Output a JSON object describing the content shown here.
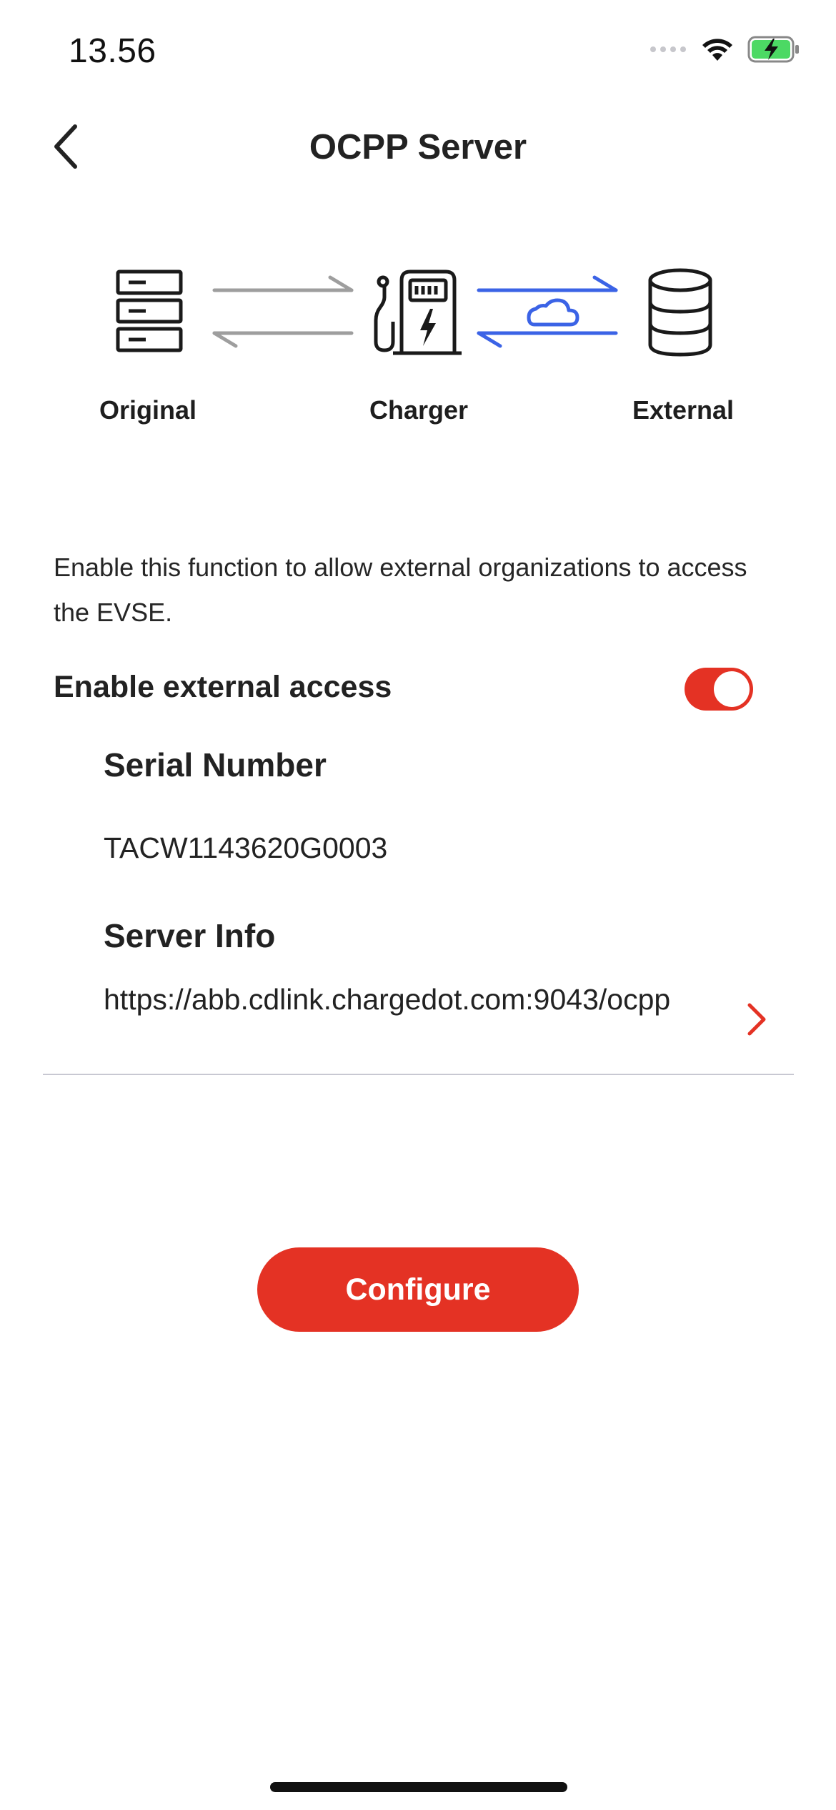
{
  "status_bar": {
    "time": "13.56",
    "icons": [
      "signal-icon",
      "wifi-icon",
      "battery-charging-icon"
    ],
    "battery_color": "#4cd964"
  },
  "header": {
    "title": "OCPP Server",
    "back_icon": "chevron-left-icon"
  },
  "diagram": {
    "nodes": [
      {
        "label": "Original",
        "icon": "server-rack-icon"
      },
      {
        "label": "Charger",
        "icon": "charging-station-icon"
      },
      {
        "label": "External",
        "icon": "database-icon"
      }
    ],
    "left_link_color": "#9e9e9e",
    "right_link_color": "#3b63e6",
    "right_link_icon": "cloud-icon"
  },
  "description": "Enable this function to allow external organizations to access the EVSE.",
  "external_access": {
    "label": "Enable external access",
    "enabled": true
  },
  "serial": {
    "heading": "Serial Number",
    "value": "TACW1143620G0003"
  },
  "server_info": {
    "heading": "Server Info",
    "value": "https://abb.cdlink.chargedot.com:9043/ocpp"
  },
  "actions": {
    "configure_label": "Configure"
  },
  "colors": {
    "accent": "#e43224",
    "link_blue": "#3b63e6"
  }
}
